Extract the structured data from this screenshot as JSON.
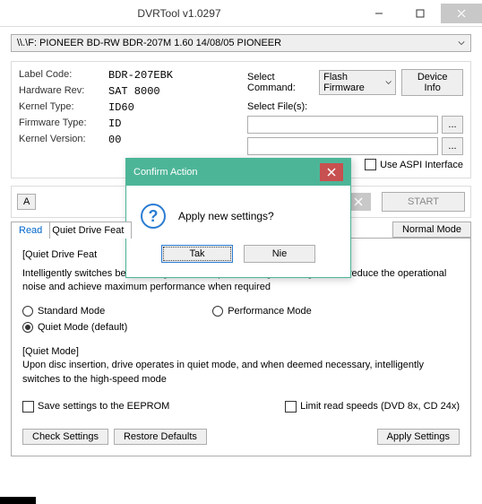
{
  "window": {
    "title": "DVRTool v1.0297"
  },
  "drive": {
    "path": "\\\\.\\F: PIONEER  BD-RW   BDR-207M 1.60  14/08/05  PIONEER"
  },
  "info": {
    "label_code_lbl": "Label Code:",
    "label_code": "BDR-207EBK",
    "hardware_rev_lbl": "Hardware Rev:",
    "hardware_rev": "SAT 8000",
    "kernel_type_lbl": "Kernel Type:",
    "kernel_type": "ID60",
    "firmware_type_lbl": "Firmware Type:",
    "firmware_type": "ID",
    "kernel_version_lbl": "Kernel Version:",
    "kernel_version": "00"
  },
  "cmd": {
    "select_cmd_lbl": "Select Command:",
    "select_cmd_value": "Flash Firmware",
    "device_info_btn": "Device Info",
    "select_files_lbl": "Select File(s):",
    "file_browse": "...",
    "use_aspi": "Use ASPI Interface"
  },
  "mid": {
    "a_btn": "A",
    "start": "START"
  },
  "tabs": {
    "read": "Read",
    "quiet": "Quiet Drive Feat",
    "normal_mode": "Normal Mode"
  },
  "panel": {
    "title": "[Quiet Drive Feat",
    "desc": "Intelligently switches between high and low speed setting, allowing to both reduce the operational noise and achieve maximum performance when required",
    "standard": "Standard Mode",
    "performance": "Performance Mode",
    "quiet": "Quiet Mode (default)",
    "mode_title": "[Quiet Mode]",
    "mode_desc": "Upon disc insertion, drive operates in quiet mode, and when deemed necessary, intelligently switches to the high-speed mode",
    "save_eeprom": "Save settings to the EEPROM",
    "limit_read": "Limit read speeds (DVD 8x, CD 24x)",
    "check_btn": "Check Settings",
    "restore_btn": "Restore Defaults",
    "apply_btn": "Apply Settings"
  },
  "dialog": {
    "title": "Confirm Action",
    "message": "Apply new settings?",
    "yes": "Tak",
    "no": "Nie"
  }
}
